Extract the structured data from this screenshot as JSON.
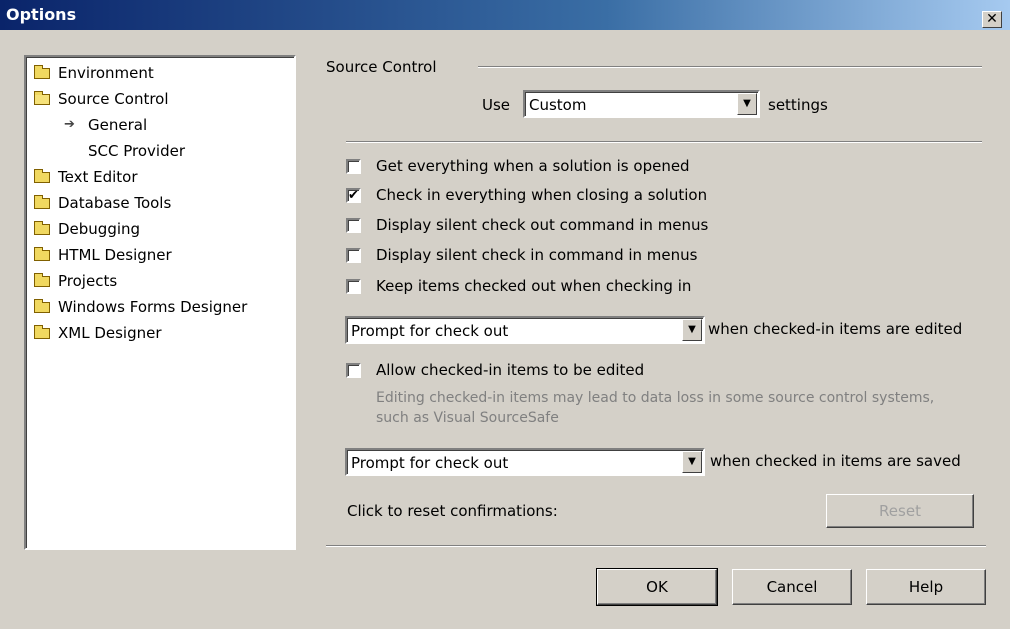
{
  "window": {
    "title": "Options",
    "close_glyph": "✕"
  },
  "tree": {
    "items": [
      {
        "label": "Environment",
        "icon": "folder-icon",
        "depth": 0
      },
      {
        "label": "Source Control",
        "icon": "open-folder-icon",
        "depth": 0
      },
      {
        "label": "General",
        "icon": "arrow-right-icon",
        "depth": 1,
        "selected": true
      },
      {
        "label": "SCC Provider",
        "icon": "",
        "depth": 1
      },
      {
        "label": "Text Editor",
        "icon": "folder-icon",
        "depth": 0
      },
      {
        "label": "Database Tools",
        "icon": "folder-icon",
        "depth": 0
      },
      {
        "label": "Debugging",
        "icon": "folder-icon",
        "depth": 0
      },
      {
        "label": "HTML Designer",
        "icon": "folder-icon",
        "depth": 0
      },
      {
        "label": "Projects",
        "icon": "folder-icon",
        "depth": 0
      },
      {
        "label": "Windows Forms Designer",
        "icon": "folder-icon",
        "depth": 0
      },
      {
        "label": "XML Designer",
        "icon": "folder-icon",
        "depth": 0
      }
    ]
  },
  "panel": {
    "group_label": "Source Control",
    "use_label": "Use",
    "use_combo_value": "Custom",
    "settings_label": "settings",
    "checkboxes": [
      {
        "label": "Get everything when a solution is opened",
        "checked": false
      },
      {
        "label": "Check in everything when closing a solution",
        "checked": true
      },
      {
        "label": "Display silent check out command in menus",
        "checked": false
      },
      {
        "label": "Display silent check in command in menus",
        "checked": false
      },
      {
        "label": "Keep items checked out when checking in",
        "checked": false
      }
    ],
    "edit_combo_value": "Prompt for check out",
    "edit_combo_label": "when checked-in items are edited",
    "allow_edit": {
      "label": "Allow checked-in items to be edited",
      "checked": false
    },
    "allow_edit_note": "Editing checked-in items may lead to data loss in some source control systems, such as Visual SourceSafe",
    "save_combo_value": "Prompt for check out",
    "save_combo_label": "when checked in items are saved",
    "reset_label": "Click to reset confirmations:",
    "reset_button": "Reset",
    "check_glyph": "✔",
    "dropdown_glyph": "▼"
  },
  "buttons": {
    "ok": "OK",
    "cancel": "Cancel",
    "help": "Help"
  }
}
